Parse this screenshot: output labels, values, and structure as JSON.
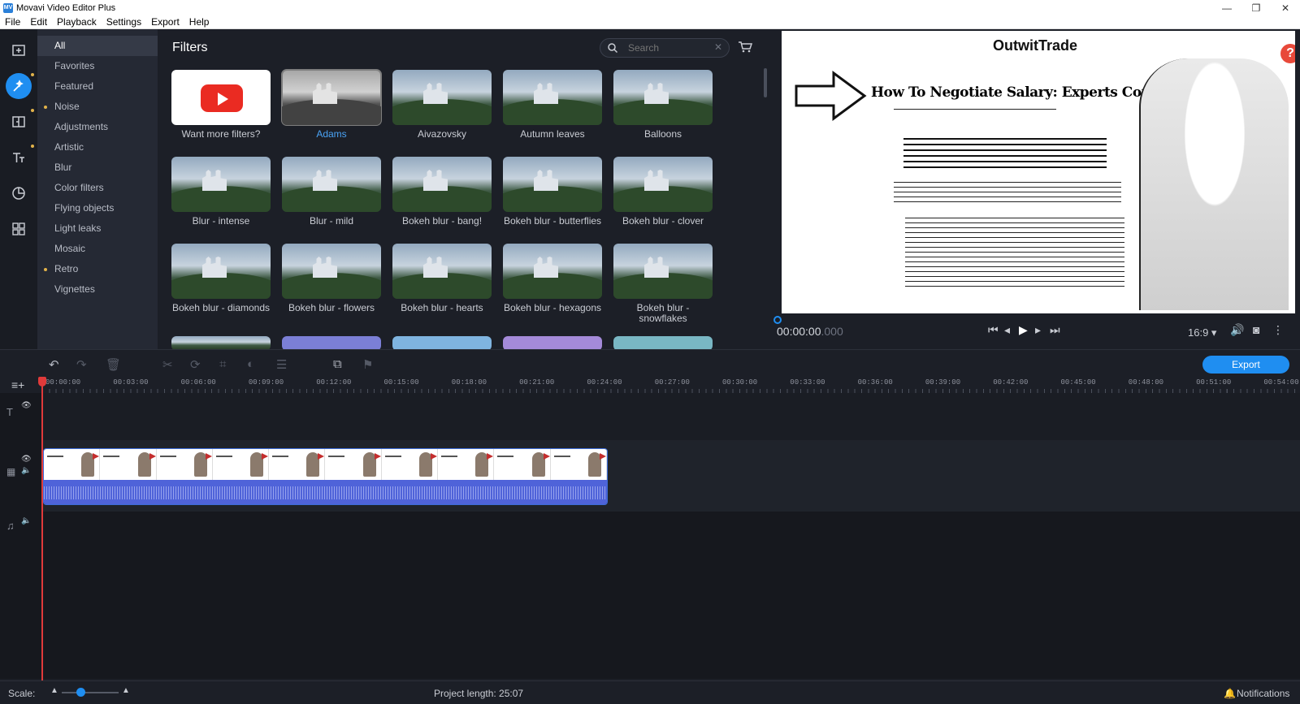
{
  "window": {
    "title": "Movavi Video Editor Plus",
    "controls": [
      "—",
      "❐",
      "✕"
    ]
  },
  "menu": [
    "File",
    "Edit",
    "Playback",
    "Settings",
    "Export",
    "Help"
  ],
  "rail": [
    "import-icon",
    "filters-icon",
    "transitions-icon",
    "titles-icon",
    "stickers-icon",
    "more-tools-icon"
  ],
  "categories": [
    {
      "label": "All",
      "dot": false
    },
    {
      "label": "Favorites",
      "dot": false
    },
    {
      "label": "Featured",
      "dot": false
    },
    {
      "label": "Noise",
      "dot": true
    },
    {
      "label": "Adjustments",
      "dot": false
    },
    {
      "label": "Artistic",
      "dot": false
    },
    {
      "label": "Blur",
      "dot": false
    },
    {
      "label": "Color filters",
      "dot": false
    },
    {
      "label": "Flying objects",
      "dot": false
    },
    {
      "label": "Light leaks",
      "dot": false
    },
    {
      "label": "Mosaic",
      "dot": false
    },
    {
      "label": "Retro",
      "dot": true
    },
    {
      "label": "Vignettes",
      "dot": false
    }
  ],
  "filters": {
    "title": "Filters",
    "search_placeholder": "Search",
    "items": [
      {
        "label": "Want more filters?",
        "kind": "youtube"
      },
      {
        "label": "Adams",
        "kind": "bw",
        "selected": true
      },
      {
        "label": "Aivazovsky",
        "kind": "normal"
      },
      {
        "label": "Autumn leaves",
        "kind": "normal"
      },
      {
        "label": "Balloons",
        "kind": "normal"
      },
      {
        "label": "Blur - intense",
        "kind": "normal"
      },
      {
        "label": "Blur - mild",
        "kind": "normal"
      },
      {
        "label": "Bokeh blur - bang!",
        "kind": "normal"
      },
      {
        "label": "Bokeh blur - butterflies",
        "kind": "normal"
      },
      {
        "label": "Bokeh blur - clover",
        "kind": "normal"
      },
      {
        "label": "Bokeh blur - diamonds",
        "kind": "normal"
      },
      {
        "label": "Bokeh blur - flowers",
        "kind": "normal"
      },
      {
        "label": "Bokeh blur - hearts",
        "kind": "normal"
      },
      {
        "label": "Bokeh blur - hexagons",
        "kind": "normal"
      },
      {
        "label": "Bokeh blur - snowflakes",
        "kind": "normal"
      }
    ]
  },
  "preview": {
    "logo": "OutwitTrade",
    "headline": "How To Negotiate Salary: Experts Comment",
    "help": "?",
    "timecode_main": "00:00:00",
    "timecode_ms": ".000",
    "aspect": "16:9 ▾"
  },
  "toolbar": {
    "export_label": "Export"
  },
  "ruler": [
    "00:00:00",
    "00:03:00",
    "00:06:00",
    "00:09:00",
    "00:12:00",
    "00:15:00",
    "00:18:00",
    "00:21:00",
    "00:24:00",
    "00:27:00",
    "00:30:00",
    "00:33:00",
    "00:36:00",
    "00:39:00",
    "00:42:00",
    "00:45:00",
    "00:48:00",
    "00:51:00",
    "00:54:00"
  ],
  "status": {
    "scale_label": "Scale:",
    "project_length": "Project length:  25:07",
    "notifications": "Notifications"
  },
  "colors": {
    "accent": "#1f8ef1",
    "playhead": "#e03a3a",
    "audio": "#4f63d9",
    "dot": "#e2b34a"
  }
}
